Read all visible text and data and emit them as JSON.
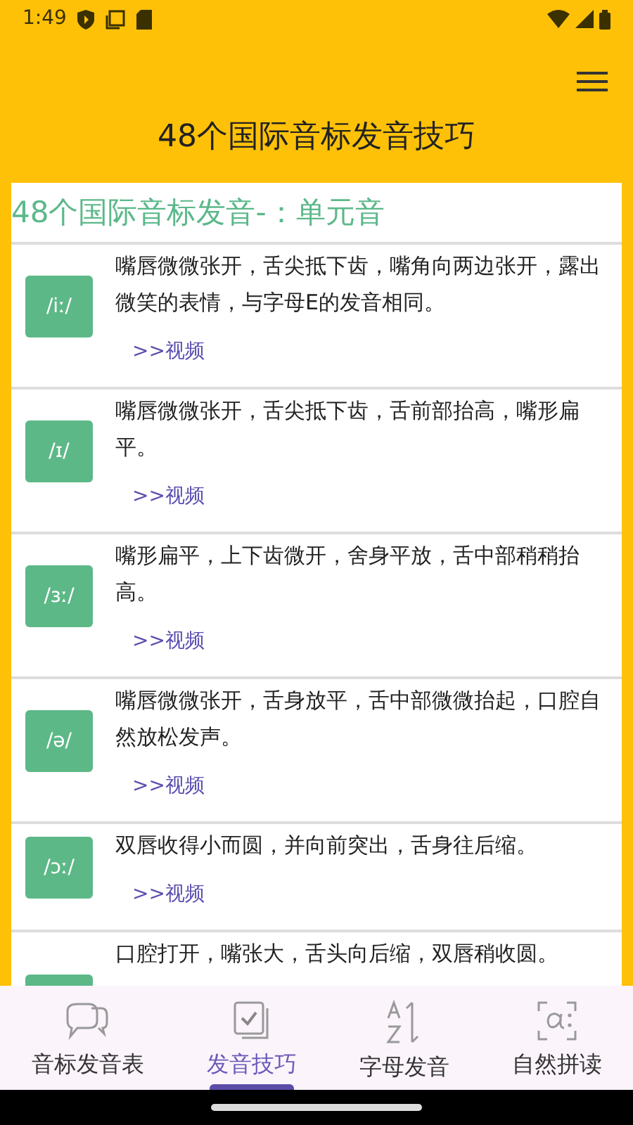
{
  "status_bar": {
    "time": "1:49"
  },
  "app_bar": {
    "title": "48个国际音标发音技巧"
  },
  "section": {
    "heading": "48个国际音标发音-：单元音"
  },
  "items": [
    {
      "phoneme": "/iː/",
      "description": "嘴唇微微张开，舌尖抵下齿，嘴角向两边张开，露出微笑的表情，与字母E的发音相同。",
      "link": ">>视频"
    },
    {
      "phoneme": "/ɪ/",
      "description": "嘴唇微微张开，舌尖抵下齿，舌前部抬高，嘴形扁平。",
      "link": ">>视频"
    },
    {
      "phoneme": "/ɜː/",
      "description": "嘴形扁平，上下齿微开，舍身平放，舌中部稍稍抬高。",
      "link": ">>视频"
    },
    {
      "phoneme": "/ə/",
      "description": "嘴唇微微张开，舌身放平，舌中部微微抬起，口腔自然放松发声。",
      "link": ">>视频"
    },
    {
      "phoneme": "/ɔː/",
      "description": "双唇收得小而圆，并向前突出，舌身往后缩。",
      "link": ">>视频"
    },
    {
      "description": "口腔打开，嘴张大，舌头向后缩，双唇稍收圆。"
    }
  ],
  "bottom_nav": [
    {
      "label": "音标发音表",
      "selected": false
    },
    {
      "label": "发音技巧",
      "selected": true
    },
    {
      "label": "字母发音",
      "selected": false
    },
    {
      "label": "自然拼读",
      "selected": false
    }
  ]
}
